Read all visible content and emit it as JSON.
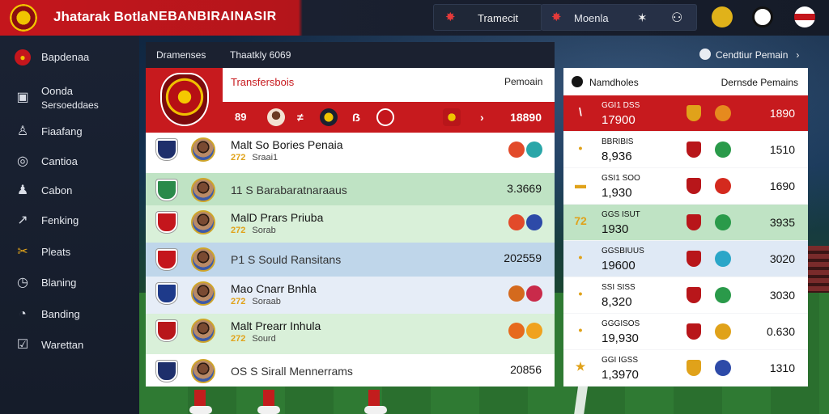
{
  "topbar": {
    "brand": "Jhatarak Botla",
    "subtitle": "NEBANBIRAINASIR",
    "transfer_label": "Tramecit",
    "search_label": "Moenla",
    "colors": {
      "red": "#c4161c",
      "dark": "#151b28"
    }
  },
  "sidebar": {
    "items": [
      {
        "label": "Bapdenaa",
        "icon": "club-crest-icon"
      },
      {
        "label": "Oonda",
        "label2": "Sersoeddaes",
        "icon": "calendar-icon"
      },
      {
        "label": "Fiaafang",
        "icon": "person-icon"
      },
      {
        "label": "Cantioa",
        "icon": "target-icon"
      },
      {
        "label": "Cabon",
        "icon": "user-icon"
      },
      {
        "label": "Fenking",
        "icon": "trend-icon"
      },
      {
        "label": "Pleats",
        "icon": "whistle-icon"
      },
      {
        "label": "Blaning",
        "icon": "clock-icon"
      },
      {
        "label": "Banding",
        "icon": "chat-icon"
      },
      {
        "label": "Warettan",
        "icon": "clipboard-icon"
      }
    ]
  },
  "left_panel": {
    "header_a": "Dramenses",
    "header_b": "Thaatkly 6069",
    "feature": {
      "title": "Transfersbois",
      "right_label": "Pemoain",
      "items": [
        "89",
        "≠",
        "ẞ",
        "›"
      ],
      "value": "18890"
    },
    "rows": [
      {
        "name": "Malt So Bories Penaia",
        "num": "272",
        "sub": "Sraai1",
        "value": "",
        "bg": "#ffffff",
        "flag": "#1e2f6b",
        "c1": "#e24a2a",
        "c2": "#2aa6a8"
      },
      {
        "name": "11 S Barabaratnaraaus",
        "num": "",
        "sub": "",
        "value": "3.3669",
        "bg": "#bfe3c4",
        "flag": "#2a8a4a",
        "c1": "",
        "c2": ""
      },
      {
        "name": "MalD Prars Priuba",
        "num": "272",
        "sub": "Sorab",
        "value": "",
        "bg": "#d9f0d9",
        "flag": "#c4161c",
        "c1": "#e24a2a",
        "c2": "#2d4aa8"
      },
      {
        "name": "P1 S Sould Ransitans",
        "num": "",
        "sub": "",
        "value": "202559",
        "bg": "#bfd6ea",
        "flag": "#c4161c",
        "c1": "",
        "c2": ""
      },
      {
        "name": "Mao Cnarr Bnhla",
        "num": "272",
        "sub": "Soraab",
        "value": "",
        "bg": "#e6edf7",
        "flag": "#1e3a8a",
        "c1": "#d46a1e",
        "c2": "#c92a4a"
      },
      {
        "name": "Malt Prearr Inhula",
        "num": "272",
        "sub": "Sourd",
        "value": "",
        "bg": "#d9f0d9",
        "flag": "#b8161a",
        "c1": "#e66a1e",
        "c2": "#f0a21e"
      },
      {
        "name": "OS S Sirall Mennerrams",
        "num": "",
        "sub": "",
        "value": "20856",
        "bg": "#ffffff",
        "flag": "#1e2f6b",
        "c1": "",
        "c2": ""
      }
    ]
  },
  "right_panel": {
    "link_label": "Cendtiur Pemain",
    "header_a": "Namdholes",
    "header_b": "Dernsde Pemains",
    "rows": [
      {
        "lead": "\\",
        "line1": "GGI1 DSS",
        "line2": "17900",
        "value": "1890",
        "bg": "#c71a1e",
        "fg": "#ffffff",
        "b1": "#e0a21a",
        "b2": "#e68a1e"
      },
      {
        "lead": "•",
        "line1": "BBRIBIS",
        "line2": "8,936",
        "value": "1510",
        "bg": "#ffffff",
        "fg": "#111111",
        "b1": "#b8161a",
        "b2": "#2a9a4a"
      },
      {
        "lead": "▬",
        "line1": "GSI1 SOO",
        "line2": "1,930",
        "value": "1690",
        "bg": "#ffffff",
        "fg": "#111111",
        "b1": "#b8161a",
        "b2": "#d42a1e"
      },
      {
        "lead": "72",
        "line1": "GGS ISUT",
        "line2": "1930",
        "value": "3935",
        "bg": "#bfe3c4",
        "fg": "#111111",
        "b1": "#b8161a",
        "b2": "#2a9a4a"
      },
      {
        "lead": "•",
        "line1": "GGSBIUUS",
        "line2": "19600",
        "value": "3020",
        "bg": "#dfe9f5",
        "fg": "#111111",
        "b1": "#b8161a",
        "b2": "#2aa6c8"
      },
      {
        "lead": "•",
        "line1": "SSI SISS",
        "line2": "8,320",
        "value": "3030",
        "bg": "#ffffff",
        "fg": "#111111",
        "b1": "#b8161a",
        "b2": "#2a9a4a"
      },
      {
        "lead": "•",
        "line1": "GGGISOS",
        "line2": "19,930",
        "value": "0.630",
        "bg": "#ffffff",
        "fg": "#111111",
        "b1": "#b8161a",
        "b2": "#e0a21a"
      },
      {
        "lead": "★",
        "line1": "GGI IGSS",
        "line2": "1,3970",
        "value": "1310",
        "bg": "#ffffff",
        "fg": "#111111",
        "b1": "#e0a21a",
        "b2": "#2d4aa8"
      }
    ]
  }
}
